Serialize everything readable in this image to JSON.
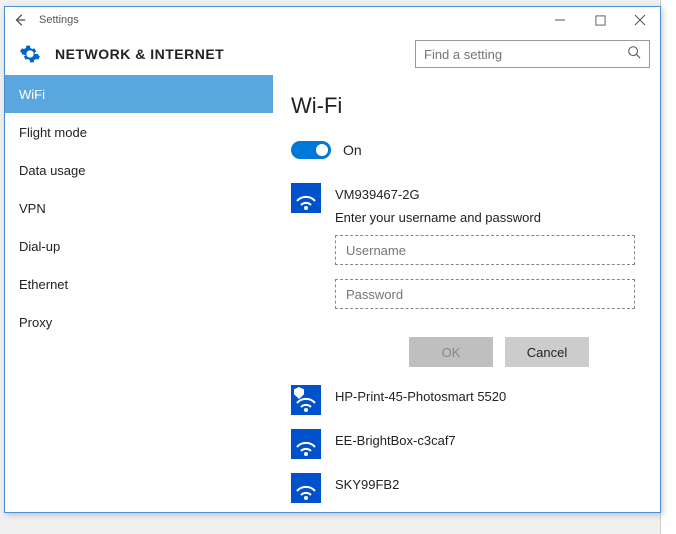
{
  "window": {
    "title": "Settings"
  },
  "header": {
    "title": "NETWORK & INTERNET",
    "search_placeholder": "Find a setting"
  },
  "sidebar": {
    "items": [
      {
        "label": "WiFi",
        "active": true
      },
      {
        "label": "Flight mode",
        "active": false
      },
      {
        "label": "Data usage",
        "active": false
      },
      {
        "label": "VPN",
        "active": false
      },
      {
        "label": "Dial-up",
        "active": false
      },
      {
        "label": "Ethernet",
        "active": false
      },
      {
        "label": "Proxy",
        "active": false
      }
    ]
  },
  "main": {
    "page_title": "Wi-Fi",
    "toggle": {
      "state": "On"
    },
    "connect": {
      "ssid": "VM939467-2G",
      "prompt": "Enter your username and password",
      "username_placeholder": "Username",
      "password_placeholder": "Password",
      "ok_label": "OK",
      "cancel_label": "Cancel"
    },
    "networks": [
      {
        "ssid": "HP-Print-45-Photosmart 5520",
        "secured": true
      },
      {
        "ssid": "EE-BrightBox-c3caf7",
        "secured": false
      },
      {
        "ssid": "SKY99FB2",
        "secured": false
      }
    ]
  }
}
